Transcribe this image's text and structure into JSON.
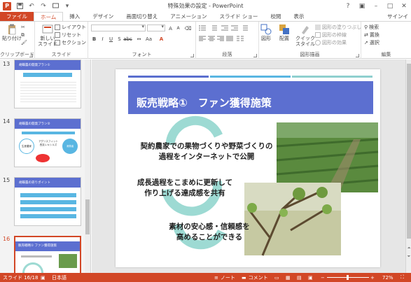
{
  "window": {
    "title": "特殊効果の設定 - PowerPoint",
    "signin": "サインイ"
  },
  "tabs": [
    "ファイル",
    "ホーム",
    "挿入",
    "デザイン",
    "画面切り替え",
    "アニメーション",
    "スライド ショー",
    "校閲",
    "表示"
  ],
  "ribbon": {
    "clipboard": {
      "paste": "貼り付け",
      "label": "クリップボード"
    },
    "slides": {
      "new_slide_1": "新しい",
      "new_slide_2": "スライド",
      "layout": "レイアウト",
      "reset": "リセット",
      "section": "セクション",
      "label": "スライド"
    },
    "font": {
      "label": "フォント"
    },
    "paragraph": {
      "label": "段落"
    },
    "drawing": {
      "shapes": "図形",
      "arrange": "配置",
      "quick_styles_1": "クイック",
      "quick_styles_2": "スタイル",
      "fill": "図形の塗りつぶし",
      "outline": "図形の枠線",
      "effects": "図形の効果",
      "label": "図形描画"
    },
    "editing": {
      "find": "検索",
      "replace": "置換",
      "select": "選択",
      "label": "編集"
    }
  },
  "thumbnails": [
    {
      "num": "13",
      "title": "胡蝶農の開発プラン①"
    },
    {
      "num": "14",
      "title": "胡蝶農の開発プラン②",
      "boxes": [
        "生産農家",
        "アグリスフィット 西友レキシルズ",
        "消費者"
      ]
    },
    {
      "num": "15",
      "title": "胡蝶農の売りポイント"
    },
    {
      "num": "16",
      "title": "販売戦略① ファン獲得施策",
      "selected": true
    }
  ],
  "slide": {
    "title": "販売戦略①　ファン獲得施策",
    "point1_line1": "契約農家での果物づくりや野菜づくりの",
    "point1_line2": "過程をインターネットで公開",
    "point2_line1": "成長過程をこまめに更新して",
    "point2_line2": "作り上げる達成感を共有",
    "point3_line1": "素材の安心感・信頼感を",
    "point3_line2": "高めることができる",
    "band_colors": [
      "#5b6fcf",
      "#59b6e2",
      "#8fd0cf"
    ],
    "header_color": "#5c6fd0",
    "cycle_color": "#9ddad3"
  },
  "status": {
    "slide": "スライド 16/18",
    "lang": "日本語",
    "notes": "ノート",
    "comments": "コメント",
    "zoom": "72%"
  }
}
